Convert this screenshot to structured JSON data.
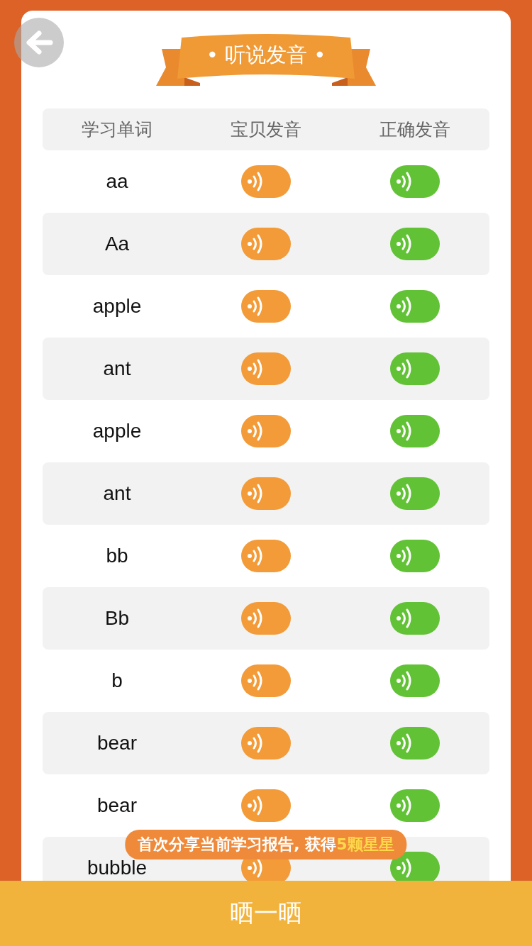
{
  "title": "• 听说发音 •",
  "columns": [
    "学习单词",
    "宝贝发音",
    "正确发音"
  ],
  "rows": [
    {
      "word": "aa"
    },
    {
      "word": "Aa"
    },
    {
      "word": "apple"
    },
    {
      "word": "ant"
    },
    {
      "word": "apple"
    },
    {
      "word": "ant"
    },
    {
      "word": "bb"
    },
    {
      "word": "Bb"
    },
    {
      "word": "b"
    },
    {
      "word": "bear"
    },
    {
      "word": "bear"
    },
    {
      "word": "bubble"
    }
  ],
  "share_tip": {
    "text": "首次分享当前学习报告, 获得",
    "highlight": "5颗星星"
  },
  "share_button": "晒一晒"
}
